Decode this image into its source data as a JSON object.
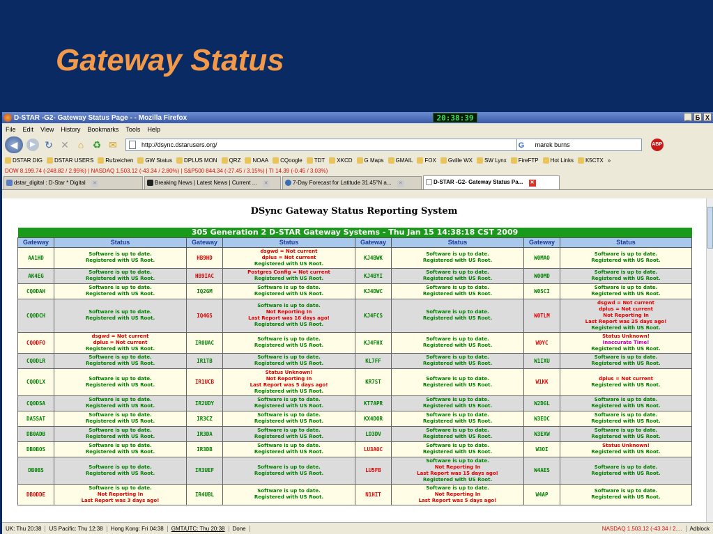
{
  "slide": {
    "title": "Gateway Status"
  },
  "window": {
    "title": "D-STAR -G2- Gateway Status Page - - Mozilla Firefox",
    "clock": "20:38:39",
    "controls": [
      "_",
      "Б",
      "X"
    ]
  },
  "menu": [
    "File",
    "Edit",
    "View",
    "History",
    "Bookmarks",
    "Tools",
    "Help"
  ],
  "nav": {
    "url": "http://dsync.dstarusers.org/",
    "search_value": "marek burns",
    "search_engine": "G",
    "abp": "ABP"
  },
  "bookmarks": [
    "DSTAR DIG",
    "DSTAR USERS",
    "Rufzeichen",
    "GW Status",
    "DPLUS MON",
    "QRZ",
    "NOAA",
    "CQoogle",
    "TDT",
    "XKCD",
    "G Maps",
    "GMAIL",
    "FOX",
    "Gville WX",
    "SW Lynx",
    "FireFTP",
    "Hot Links",
    "K5CTX",
    "»"
  ],
  "ticker": "DOW 8,199.74 (-248.82 / 2.95%)  |  NASDAQ 1,503.12 (-43.34 / 2.80%)  |  S&P500 844.34 (-27.45 / 3.15%)  |  TI 14.39 (-0.45 / 3.03%)",
  "tabs": [
    {
      "label": "dstar_digital : D-Star * Digital",
      "active": false
    },
    {
      "label": "Breaking News | Latest News | Current ...",
      "active": false
    },
    {
      "label": "7-Day Forecast for Latitude 31.45°N a...",
      "active": false
    },
    {
      "label": "D-STAR -G2- Gateway Status Pa...",
      "active": true
    }
  ],
  "page": {
    "heading": "DSync Gateway Status Reporting System",
    "banner": "305 Generation 2 D-STAR Gateway Systems - Thu Jan 15 14:38:18 CST 2009",
    "col_gateway": "Gateway",
    "col_status": "Status"
  },
  "rows": [
    [
      {
        "gw": "AA1HD",
        "gc": "ok",
        "s": [
          [
            "ok",
            "Software is up to date."
          ],
          [
            "ok",
            "Registered with US Root."
          ]
        ]
      },
      {
        "gw": "HB9HD",
        "gc": "bad",
        "s": [
          [
            "bad",
            "dsgwd = Not current"
          ],
          [
            "bad",
            "dplus = Not current"
          ],
          [
            "ok",
            "Registered with US Root."
          ]
        ]
      },
      {
        "gw": "KJ4BWK",
        "gc": "ok",
        "s": [
          [
            "ok",
            "Software is up to date."
          ],
          [
            "ok",
            "Registered with US Root."
          ]
        ]
      },
      {
        "gw": "W0MAO",
        "gc": "ok",
        "s": [
          [
            "ok",
            "Software is up to date."
          ],
          [
            "ok",
            "Registered with US Root."
          ]
        ]
      }
    ],
    [
      {
        "gw": "AK4EG",
        "gc": "ok",
        "s": [
          [
            "ok",
            "Software is up to date."
          ],
          [
            "ok",
            "Registered with US Root."
          ]
        ]
      },
      {
        "gw": "HB9IAC",
        "gc": "bad",
        "s": [
          [
            "bad",
            "Postgres Config = Not current"
          ],
          [
            "ok",
            "Registered with US Root."
          ]
        ]
      },
      {
        "gw": "KJ4BYI",
        "gc": "ok",
        "s": [
          [
            "ok",
            "Software is up to date."
          ],
          [
            "ok",
            "Registered with US Root."
          ]
        ]
      },
      {
        "gw": "W0OMD",
        "gc": "ok",
        "s": [
          [
            "ok",
            "Software is up to date."
          ],
          [
            "ok",
            "Registered with US Root."
          ]
        ]
      }
    ],
    [
      {
        "gw": "CQ0DAH",
        "gc": "ok",
        "s": [
          [
            "ok",
            "Software is up to date."
          ],
          [
            "ok",
            "Registered with US Root."
          ]
        ]
      },
      {
        "gw": "IQ2GM",
        "gc": "ok",
        "s": [
          [
            "ok",
            "Software is up to date."
          ],
          [
            "ok",
            "Registered with US Root."
          ]
        ]
      },
      {
        "gw": "KJ4DWC",
        "gc": "ok",
        "s": [
          [
            "ok",
            "Software is up to date."
          ],
          [
            "ok",
            "Registered with US Root."
          ]
        ]
      },
      {
        "gw": "W0SCI",
        "gc": "ok",
        "s": [
          [
            "ok",
            "Software is up to date."
          ],
          [
            "ok",
            "Registered with US Root."
          ]
        ]
      }
    ],
    [
      {
        "gw": "CQ0DCH",
        "gc": "ok",
        "s": [
          [
            "ok",
            "Software is up to date."
          ],
          [
            "ok",
            "Registered with US Root."
          ]
        ]
      },
      {
        "gw": "IQ4GS",
        "gc": "bad",
        "s": [
          [
            "ok",
            "Software is up to date."
          ],
          [
            "bad",
            "Not Reporting In"
          ],
          [
            "bad",
            "Last Report was 16 days ago!"
          ],
          [
            "ok",
            "Registered with US Root."
          ]
        ]
      },
      {
        "gw": "KJ4FCS",
        "gc": "ok",
        "s": [
          [
            "ok",
            "Software is up to date."
          ],
          [
            "ok",
            "Registered with US Root."
          ]
        ]
      },
      {
        "gw": "W0TLM",
        "gc": "bad",
        "s": [
          [
            "bad",
            "dsgwd = Not current"
          ],
          [
            "bad",
            "dplus = Not current"
          ],
          [
            "bad",
            "Not Reporting In"
          ],
          [
            "bad",
            "Last Report was 25 days ago!"
          ],
          [
            "ok",
            "Registered with US Root."
          ]
        ]
      }
    ],
    [
      {
        "gw": "CQ0DFO",
        "gc": "bad",
        "s": [
          [
            "bad",
            "dsgwd = Not current"
          ],
          [
            "bad",
            "dplus = Not current"
          ],
          [
            "ok",
            "Registered with US Root."
          ]
        ]
      },
      {
        "gw": "IR0UAC",
        "gc": "ok",
        "s": [
          [
            "ok",
            "Software is up to date."
          ],
          [
            "ok",
            "Registered with US Root."
          ]
        ]
      },
      {
        "gw": "KJ4FHX",
        "gc": "ok",
        "s": [
          [
            "ok",
            "Software is up to date."
          ],
          [
            "ok",
            "Registered with US Root."
          ]
        ]
      },
      {
        "gw": "W0YC",
        "gc": "bad",
        "s": [
          [
            "bad",
            "Status Unknown!"
          ],
          [
            "mag",
            "Inaccurate Time!"
          ],
          [
            "ok",
            "Registered with US Root."
          ]
        ]
      }
    ],
    [
      {
        "gw": "CQ0DLR",
        "gc": "ok",
        "s": [
          [
            "ok",
            "Software is up to date."
          ],
          [
            "ok",
            "Registered with US Root."
          ]
        ]
      },
      {
        "gw": "IR1TB",
        "gc": "ok",
        "s": [
          [
            "ok",
            "Software is up to date."
          ],
          [
            "ok",
            "Registered with US Root."
          ]
        ]
      },
      {
        "gw": "KL7FF",
        "gc": "ok",
        "s": [
          [
            "ok",
            "Software is up to date."
          ],
          [
            "ok",
            "Registered with US Root."
          ]
        ]
      },
      {
        "gw": "W1IXU",
        "gc": "ok",
        "s": [
          [
            "ok",
            "Software is up to date."
          ],
          [
            "ok",
            "Registered with US Root."
          ]
        ]
      }
    ],
    [
      {
        "gw": "CQ0DLX",
        "gc": "ok",
        "s": [
          [
            "ok",
            "Software is up to date."
          ],
          [
            "ok",
            "Registered with US Root."
          ]
        ]
      },
      {
        "gw": "IR1UCB",
        "gc": "bad",
        "s": [
          [
            "bad",
            "Status Unknown!"
          ],
          [
            "bad",
            "Not Reporting In"
          ],
          [
            "bad",
            "Last Report was 5 days ago!"
          ],
          [
            "ok",
            "Registered with US Root."
          ]
        ]
      },
      {
        "gw": "KR7ST",
        "gc": "ok",
        "s": [
          [
            "ok",
            "Software is up to date."
          ],
          [
            "ok",
            "Registered with US Root."
          ]
        ]
      },
      {
        "gw": "W1KK",
        "gc": "bad",
        "s": [
          [
            "bad",
            "dplus = Not current"
          ],
          [
            "ok",
            "Registered with US Root."
          ]
        ]
      }
    ],
    [
      {
        "gw": "CQ0DSA",
        "gc": "ok",
        "s": [
          [
            "ok",
            "Software is up to date."
          ],
          [
            "ok",
            "Registered with US Root."
          ]
        ]
      },
      {
        "gw": "IR2UDY",
        "gc": "ok",
        "s": [
          [
            "ok",
            "Software is up to date."
          ],
          [
            "ok",
            "Registered with US Root."
          ]
        ]
      },
      {
        "gw": "KT7APR",
        "gc": "ok",
        "s": [
          [
            "ok",
            "Software is up to date."
          ],
          [
            "ok",
            "Registered with US Root."
          ]
        ]
      },
      {
        "gw": "W2DGL",
        "gc": "ok",
        "s": [
          [
            "ok",
            "Software is up to date."
          ],
          [
            "ok",
            "Registered with US Root."
          ]
        ]
      }
    ],
    [
      {
        "gw": "DA5SAT",
        "gc": "ok",
        "s": [
          [
            "ok",
            "Software is up to date."
          ],
          [
            "ok",
            "Registered with US Root."
          ]
        ]
      },
      {
        "gw": "IR3CZ",
        "gc": "ok",
        "s": [
          [
            "ok",
            "Software is up to date."
          ],
          [
            "ok",
            "Registered with US Root."
          ]
        ]
      },
      {
        "gw": "KX4DOR",
        "gc": "ok",
        "s": [
          [
            "ok",
            "Software is up to date."
          ],
          [
            "ok",
            "Registered with US Root."
          ]
        ]
      },
      {
        "gw": "W3EOC",
        "gc": "ok",
        "s": [
          [
            "ok",
            "Software is up to date."
          ],
          [
            "ok",
            "Registered with US Root."
          ]
        ]
      }
    ],
    [
      {
        "gw": "DB0ADB",
        "gc": "ok",
        "s": [
          [
            "ok",
            "Software is up to date."
          ],
          [
            "ok",
            "Registered with US Root."
          ]
        ]
      },
      {
        "gw": "IR3DA",
        "gc": "ok",
        "s": [
          [
            "ok",
            "Software is up to date."
          ],
          [
            "ok",
            "Registered with US Root."
          ]
        ]
      },
      {
        "gw": "LD3DV",
        "gc": "ok",
        "s": [
          [
            "ok",
            "Software is up to date."
          ],
          [
            "ok",
            "Registered with US Root."
          ]
        ]
      },
      {
        "gw": "W3EXW",
        "gc": "ok",
        "s": [
          [
            "ok",
            "Software is up to date."
          ],
          [
            "ok",
            "Registered with US Root."
          ]
        ]
      }
    ],
    [
      {
        "gw": "DB0BOS",
        "gc": "ok",
        "s": [
          [
            "ok",
            "Software is up to date."
          ],
          [
            "ok",
            "Registered with US Root."
          ]
        ]
      },
      {
        "gw": "IR3DB",
        "gc": "ok",
        "s": [
          [
            "ok",
            "Software is up to date."
          ],
          [
            "ok",
            "Registered with US Root."
          ]
        ]
      },
      {
        "gw": "LU3AOC",
        "gc": "bad",
        "s": [
          [
            "ok",
            "Software is up to date."
          ],
          [
            "ok",
            "Registered with US Root."
          ]
        ]
      },
      {
        "gw": "W3OI",
        "gc": "ok",
        "s": [
          [
            "bad",
            "Status Unknown!"
          ],
          [
            "ok",
            "Registered with US Root."
          ]
        ]
      }
    ],
    [
      {
        "gw": "DB0BS",
        "gc": "ok",
        "s": [
          [
            "ok",
            "Software is up to date."
          ],
          [
            "ok",
            "Registered with US Root."
          ]
        ]
      },
      {
        "gw": "IR3UEF",
        "gc": "ok",
        "s": [
          [
            "ok",
            "Software is up to date."
          ],
          [
            "ok",
            "Registered with US Root."
          ]
        ]
      },
      {
        "gw": "LU5FB",
        "gc": "bad",
        "s": [
          [
            "ok",
            "Software is up to date."
          ],
          [
            "bad",
            "Not Reporting In"
          ],
          [
            "bad",
            "Last Report was 15 days ago!"
          ],
          [
            "ok",
            "Registered with US Root."
          ]
        ]
      },
      {
        "gw": "W4AES",
        "gc": "ok",
        "s": [
          [
            "ok",
            "Software is up to date."
          ],
          [
            "ok",
            "Registered with US Root."
          ]
        ]
      }
    ],
    [
      {
        "gw": "DB0DDE",
        "gc": "bad",
        "s": [
          [
            "ok",
            "Software is up to date."
          ],
          [
            "bad",
            "Not Reporting In"
          ],
          [
            "bad",
            "Last Report was 3 days ago!"
          ]
        ]
      },
      {
        "gw": "IR4UBL",
        "gc": "ok",
        "s": [
          [
            "ok",
            "Software is up to date."
          ],
          [
            "ok",
            "Registered with US Root."
          ]
        ]
      },
      {
        "gw": "N1HIT",
        "gc": "bad",
        "s": [
          [
            "ok",
            "Software is up to date."
          ],
          [
            "bad",
            "Not Reporting In"
          ],
          [
            "bad",
            "Last Report was 5 days ago!"
          ]
        ]
      },
      {
        "gw": "W4AP",
        "gc": "ok",
        "s": [
          [
            "ok",
            "Software is up to date."
          ],
          [
            "ok",
            "Registered with US Root."
          ]
        ]
      }
    ]
  ],
  "statusbar": {
    "uk": "UK: Thu 20:38",
    "us": "US Pacific: Thu 12:38",
    "hk": "Hong Kong: Fri 04:38",
    "gmt": "GMT/UTC: Thu 20:38",
    "state": "Done",
    "nasdaq": "NASDAQ 1,503.12 (-43.34 / 2....",
    "adblock": "Adblock"
  }
}
